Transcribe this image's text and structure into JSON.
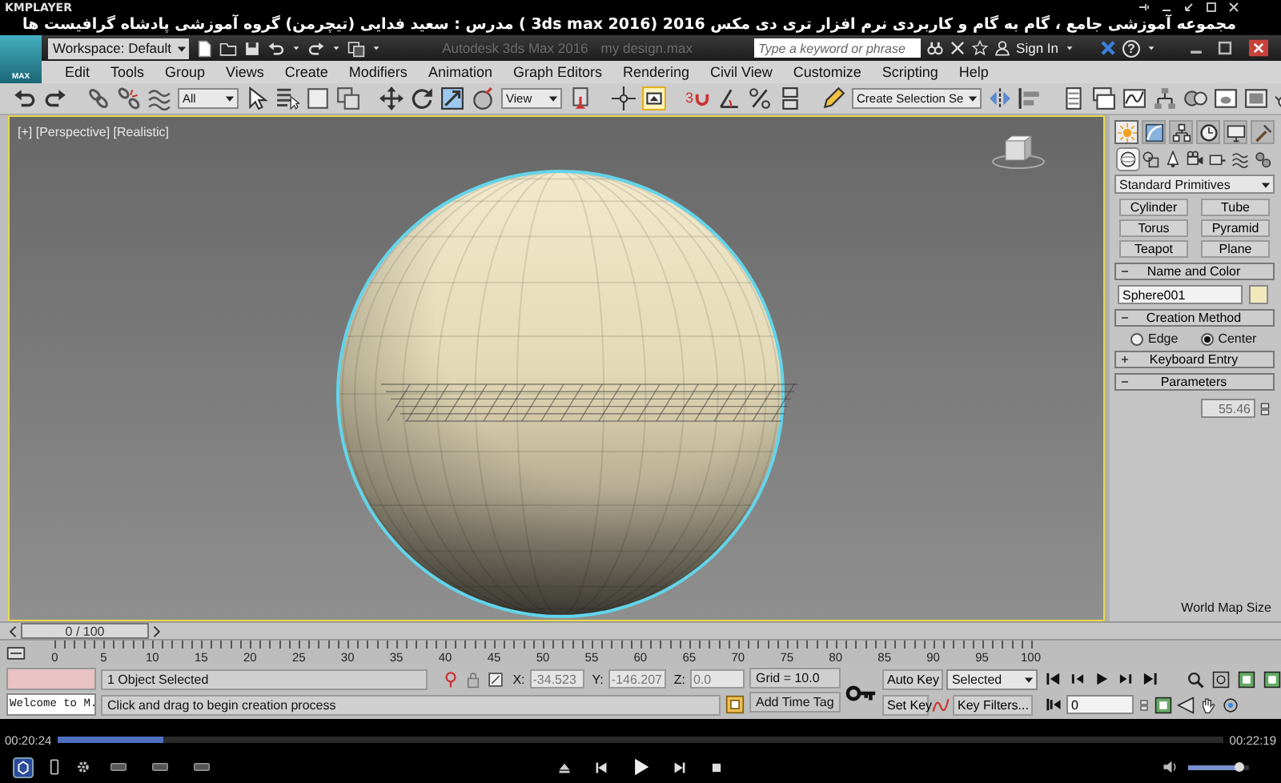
{
  "player": {
    "logo": "KMPLAYER",
    "title": "مجموعه آموزشی جامع ، گام به گام و کاربردی نرم افزار تری دی مکس 2016 (3ds max 2016 ) مدرس : سعید فدایی (تیچرمن) گروه آموزشی پادشاه گرافیست ها",
    "elapsed": "00:20:24",
    "total": "00:22:19",
    "progress": {
      "level": 0.09
    },
    "volume": {
      "level": 0.85
    }
  },
  "app": {
    "logo": "MAX",
    "workspace": "Workspace: Default",
    "title": "Autodesk 3ds Max 2016",
    "file": "my design.max",
    "search_placeholder": "Type a keyword or phrase",
    "sign_in": "Sign In",
    "help": "?"
  },
  "menu": [
    "Edit",
    "Tools",
    "Group",
    "Views",
    "Create",
    "Modifiers",
    "Animation",
    "Graph Editors",
    "Rendering",
    "Civil View",
    "Customize",
    "Scripting",
    "Help"
  ],
  "toolbar": {
    "selection_filter": "All",
    "reference_coord": "View",
    "snap_dimension": "3",
    "selection_set": "Create Selection Se"
  },
  "viewport": {
    "label": "[+] [Perspective] [Realistic]",
    "active": true
  },
  "command_panel": {
    "tabs": [
      {
        "kind": "create",
        "selected": true
      },
      {
        "kind": "modify",
        "selected": false
      },
      {
        "kind": "hierarchy",
        "selected": false
      },
      {
        "kind": "motion",
        "selected": false
      },
      {
        "kind": "display",
        "selected": false
      },
      {
        "kind": "utilities",
        "selected": false
      }
    ],
    "categories": [
      {
        "kind": "geometry",
        "selected": true
      },
      {
        "kind": "shapes",
        "selected": false
      },
      {
        "kind": "lights",
        "selected": false
      },
      {
        "kind": "cameras",
        "selected": false
      },
      {
        "kind": "helpers",
        "selected": false
      },
      {
        "kind": "space_warps",
        "selected": false
      },
      {
        "kind": "systems",
        "selected": false
      }
    ],
    "category_dropdown": "Standard Primitives",
    "object_types": [
      "Cylinder",
      "Tube",
      "Torus",
      "Pyramid",
      "Teapot",
      "Plane"
    ],
    "rollouts": [
      {
        "kind": "name_color",
        "title": "Name and Color",
        "expanded": true,
        "name": "Sphere001",
        "color": "#f2e8bc"
      },
      {
        "kind": "creation_method",
        "title": "Creation Method",
        "expanded": true,
        "options": [
          {
            "label": "Edge",
            "selected": false
          },
          {
            "label": "Center",
            "selected": true
          }
        ]
      },
      {
        "kind": "keyboard_entry",
        "title": "Keyboard Entry",
        "expanded": false
      },
      {
        "kind": "parameters",
        "title": "Parameters",
        "expanded": true,
        "value": "55.46",
        "map_size": "World Map Size"
      }
    ]
  },
  "timeline": {
    "position": "0 / 100",
    "level": 0,
    "ticks": [
      "0",
      "5",
      "10",
      "15",
      "20",
      "25",
      "30",
      "35",
      "40",
      "45",
      "50",
      "55",
      "60",
      "65",
      "70",
      "75",
      "80",
      "85",
      "90",
      "95",
      "100"
    ]
  },
  "status": {
    "listener": "Welcome to M.",
    "selection": "1 Object Selected",
    "prompt": "Click and drag to begin creation process",
    "coords": [
      {
        "axis": "X:",
        "value": "-34.523"
      },
      {
        "axis": "Y:",
        "value": "-146.207"
      },
      {
        "axis": "Z:",
        "value": "0.0"
      }
    ],
    "grid": "Grid = 10.0",
    "add_time_tag": "Add Time Tag",
    "auto_key": "Auto Key",
    "key_mode": "Selected",
    "set_key": "Set Key",
    "key_filters": "Key Filters...",
    "frame": "0"
  }
}
